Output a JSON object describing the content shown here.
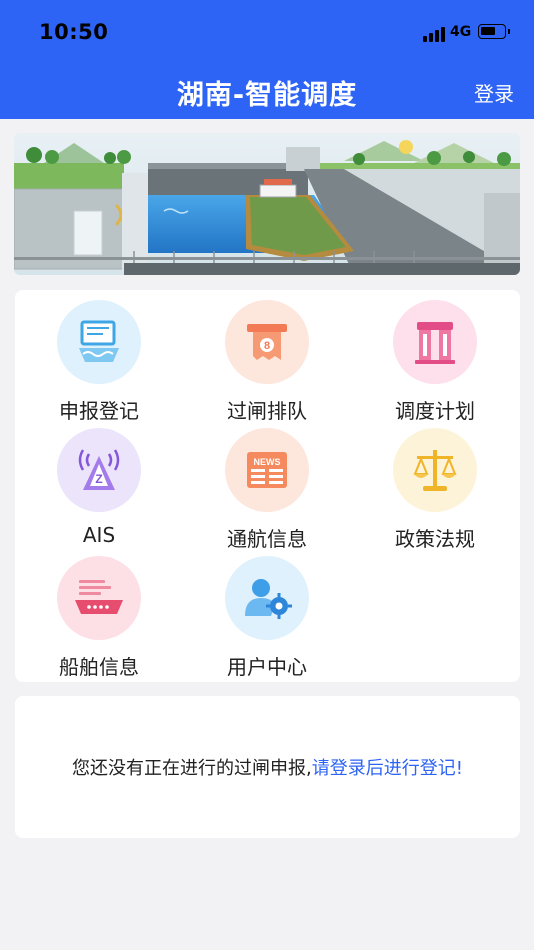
{
  "status": {
    "time": "10:50",
    "network": "4G"
  },
  "header": {
    "title": "湖南-智能调度",
    "login": "登录"
  },
  "menu": {
    "items": [
      {
        "label": "申报登记",
        "icon": "declaration-register-icon"
      },
      {
        "label": "过闸排队",
        "icon": "lock-queue-icon"
      },
      {
        "label": "调度计划",
        "icon": "dispatch-plan-icon"
      },
      {
        "label": "AIS",
        "icon": "ais-antenna-icon"
      },
      {
        "label": "通航信息",
        "icon": "news-icon"
      },
      {
        "label": "政策法规",
        "icon": "scales-icon"
      },
      {
        "label": "船舶信息",
        "icon": "ship-icon"
      },
      {
        "label": "用户中心",
        "icon": "user-settings-icon"
      }
    ]
  },
  "notice": {
    "text": "您还没有正在进行的过闸申报,",
    "link": "请登录后进行登记!"
  },
  "colors": {
    "primary": "#2e64f5"
  }
}
